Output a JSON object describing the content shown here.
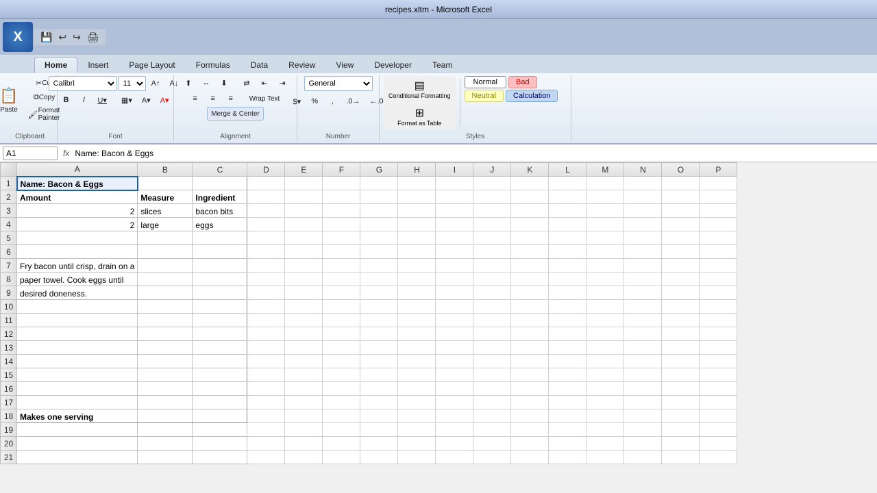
{
  "titleBar": {
    "text": "recipes.xltm - Microsoft Excel"
  },
  "tabs": [
    {
      "label": "Home",
      "active": true
    },
    {
      "label": "Insert",
      "active": false
    },
    {
      "label": "Page Layout",
      "active": false
    },
    {
      "label": "Formulas",
      "active": false
    },
    {
      "label": "Data",
      "active": false
    },
    {
      "label": "Review",
      "active": false
    },
    {
      "label": "View",
      "active": false
    },
    {
      "label": "Developer",
      "active": false
    },
    {
      "label": "Team",
      "active": false
    }
  ],
  "ribbon": {
    "clipboard": {
      "label": "Clipboard",
      "paste": "Paste",
      "cut": "Cut",
      "copy": "Copy",
      "formatPainter": "Format Painter"
    },
    "font": {
      "label": "Font",
      "fontName": "Calibri",
      "fontSize": "11",
      "bold": "B",
      "italic": "I",
      "underline": "U"
    },
    "alignment": {
      "label": "Alignment",
      "wrapText": "Wrap Text",
      "mergeCenter": "Merge & Center"
    },
    "number": {
      "label": "Number",
      "format": "General"
    },
    "styles": {
      "label": "Styles",
      "normal": "Normal",
      "bad": "Bad",
      "neutral": "Neutral",
      "calculation": "Calculation",
      "formatAsTable": "Format as\nTable",
      "conditionalFormatting": "Conditional\nFormatting"
    }
  },
  "formulaBar": {
    "cellRef": "A1",
    "content": "Name: Bacon & Eggs"
  },
  "columnHeaders": [
    "A",
    "B",
    "C",
    "D",
    "E",
    "F",
    "G",
    "H",
    "I",
    "J",
    "K",
    "L",
    "M",
    "N",
    "O",
    "P"
  ],
  "rows": [
    {
      "num": 1,
      "cells": [
        {
          "col": "A",
          "val": "Name: Bacon & Eggs",
          "bold": true,
          "selected": true
        },
        {
          "col": "B",
          "val": ""
        },
        {
          "col": "C",
          "val": ""
        }
      ]
    },
    {
      "num": 2,
      "cells": [
        {
          "col": "A",
          "val": "Amount",
          "bold": true
        },
        {
          "col": "B",
          "val": "Measure",
          "bold": true
        },
        {
          "col": "C",
          "val": "Ingredient",
          "bold": true
        }
      ]
    },
    {
      "num": 3,
      "cells": [
        {
          "col": "A",
          "val": "2",
          "right": true
        },
        {
          "col": "B",
          "val": "slices"
        },
        {
          "col": "C",
          "val": "bacon bits"
        }
      ]
    },
    {
      "num": 4,
      "cells": [
        {
          "col": "A",
          "val": "2",
          "right": true
        },
        {
          "col": "B",
          "val": "large"
        },
        {
          "col": "C",
          "val": "eggs"
        }
      ]
    },
    {
      "num": 5,
      "cells": [
        {
          "col": "A",
          "val": ""
        },
        {
          "col": "B",
          "val": ""
        },
        {
          "col": "C",
          "val": ""
        }
      ]
    },
    {
      "num": 6,
      "cells": [
        {
          "col": "A",
          "val": ""
        },
        {
          "col": "B",
          "val": ""
        },
        {
          "col": "C",
          "val": ""
        }
      ]
    },
    {
      "num": 7,
      "cells": [
        {
          "col": "A",
          "val": "Fry bacon until crisp, drain on a",
          "wrap": true
        },
        {
          "col": "B",
          "val": ""
        },
        {
          "col": "C",
          "val": ""
        }
      ]
    },
    {
      "num": 8,
      "cells": [
        {
          "col": "A",
          "val": "paper towel.  Cook eggs until"
        },
        {
          "col": "B",
          "val": ""
        },
        {
          "col": "C",
          "val": ""
        }
      ]
    },
    {
      "num": 9,
      "cells": [
        {
          "col": "A",
          "val": "desired doneness."
        },
        {
          "col": "B",
          "val": ""
        },
        {
          "col": "C",
          "val": ""
        }
      ]
    },
    {
      "num": 10,
      "cells": [
        {
          "col": "A",
          "val": ""
        },
        {
          "col": "B",
          "val": ""
        },
        {
          "col": "C",
          "val": ""
        }
      ]
    },
    {
      "num": 11,
      "cells": [
        {
          "col": "A",
          "val": ""
        },
        {
          "col": "B",
          "val": ""
        },
        {
          "col": "C",
          "val": ""
        }
      ]
    },
    {
      "num": 12,
      "cells": [
        {
          "col": "A",
          "val": ""
        },
        {
          "col": "B",
          "val": ""
        },
        {
          "col": "C",
          "val": ""
        }
      ]
    },
    {
      "num": 13,
      "cells": [
        {
          "col": "A",
          "val": ""
        },
        {
          "col": "B",
          "val": ""
        },
        {
          "col": "C",
          "val": ""
        }
      ]
    },
    {
      "num": 14,
      "cells": [
        {
          "col": "A",
          "val": ""
        },
        {
          "col": "B",
          "val": ""
        },
        {
          "col": "C",
          "val": ""
        }
      ]
    },
    {
      "num": 15,
      "cells": [
        {
          "col": "A",
          "val": ""
        },
        {
          "col": "B",
          "val": ""
        },
        {
          "col": "C",
          "val": ""
        }
      ]
    },
    {
      "num": 16,
      "cells": [
        {
          "col": "A",
          "val": ""
        },
        {
          "col": "B",
          "val": ""
        },
        {
          "col": "C",
          "val": ""
        }
      ]
    },
    {
      "num": 17,
      "cells": [
        {
          "col": "A",
          "val": ""
        },
        {
          "col": "B",
          "val": ""
        },
        {
          "col": "C",
          "val": ""
        }
      ]
    },
    {
      "num": 18,
      "cells": [
        {
          "col": "A",
          "val": "Makes one serving",
          "bold": true
        },
        {
          "col": "B",
          "val": ""
        },
        {
          "col": "C",
          "val": ""
        }
      ]
    },
    {
      "num": 19,
      "cells": [
        {
          "col": "A",
          "val": ""
        },
        {
          "col": "B",
          "val": ""
        },
        {
          "col": "C",
          "val": ""
        }
      ]
    },
    {
      "num": 20,
      "cells": [
        {
          "col": "A",
          "val": ""
        },
        {
          "col": "B",
          "val": ""
        },
        {
          "col": "C",
          "val": ""
        }
      ]
    },
    {
      "num": 21,
      "cells": [
        {
          "col": "A",
          "val": ""
        },
        {
          "col": "B",
          "val": ""
        },
        {
          "col": "C",
          "val": ""
        }
      ]
    }
  ],
  "extraCols": [
    "D",
    "E",
    "F",
    "G",
    "H",
    "I",
    "J",
    "K",
    "L",
    "M",
    "N",
    "O",
    "P"
  ]
}
